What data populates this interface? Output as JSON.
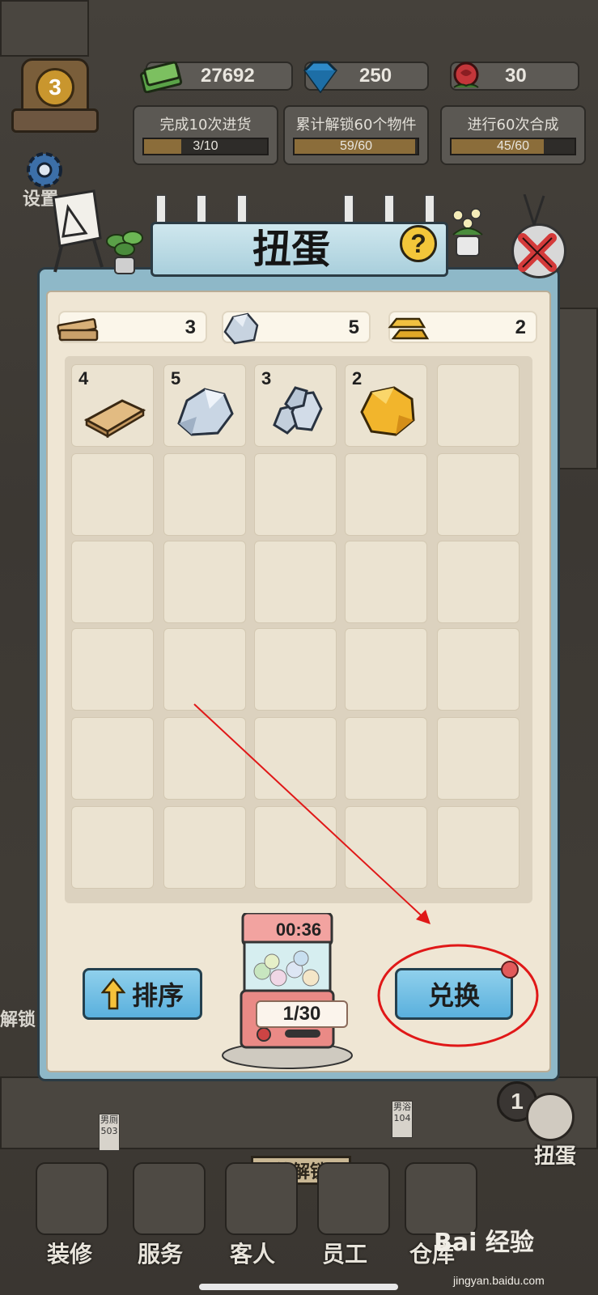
{
  "hud": {
    "level": "3",
    "cash": "27692",
    "gems": "250",
    "roses": "30"
  },
  "tasks": [
    {
      "label": "完成10次进货",
      "progress": "3/10",
      "fraction": 0.3
    },
    {
      "label": "累计解锁60个物件",
      "progress": "59/60",
      "fraction": 0.983
    },
    {
      "label": "进行60次合成",
      "progress": "45/60",
      "fraction": 0.75
    }
  ],
  "side_menu": {
    "settings": "设置"
  },
  "modal": {
    "title": "扭蛋",
    "help_icon": "?",
    "resources": [
      {
        "icon": "wood-planks-icon",
        "value": "3"
      },
      {
        "icon": "stone-icon",
        "value": "5"
      },
      {
        "icon": "gold-bars-icon",
        "value": "2"
      }
    ],
    "grid_items": [
      {
        "icon": "wood-plank-icon",
        "count": "4"
      },
      {
        "icon": "stone-icon",
        "count": "5"
      },
      {
        "icon": "stone-pile-icon",
        "count": "3"
      },
      {
        "icon": "gold-nugget-icon",
        "count": "2"
      }
    ],
    "sort_button": "排序",
    "exchange_button": "兑换",
    "gacha_timer": "00:36",
    "gacha_count": "1/30"
  },
  "bottom_nav": [
    {
      "label": "装修",
      "icon": "paintbrush-icon"
    },
    {
      "label": "服务",
      "icon": "service-icon"
    },
    {
      "label": "客人",
      "icon": "guest-icon"
    },
    {
      "label": "员工",
      "icon": "staff-icon"
    },
    {
      "label": "仓库",
      "icon": "warehouse-icon"
    }
  ],
  "map": {
    "pending_unlock": "待解锁",
    "room_male_toilet": "男厕\n503",
    "room_male_bath": "男浴\n104",
    "unlock_left": "解锁",
    "gacha_side_label": "扭蛋",
    "gacha_side_badge": "1"
  },
  "watermark": {
    "brand": "Bai 经验",
    "url": "jingyan.baidu.com"
  },
  "colors": {
    "modal_frame": "#8eb8c8",
    "modal_panel": "#efe6d4",
    "button_blue": "#5ab0dd",
    "annotation_red": "#e01818"
  }
}
